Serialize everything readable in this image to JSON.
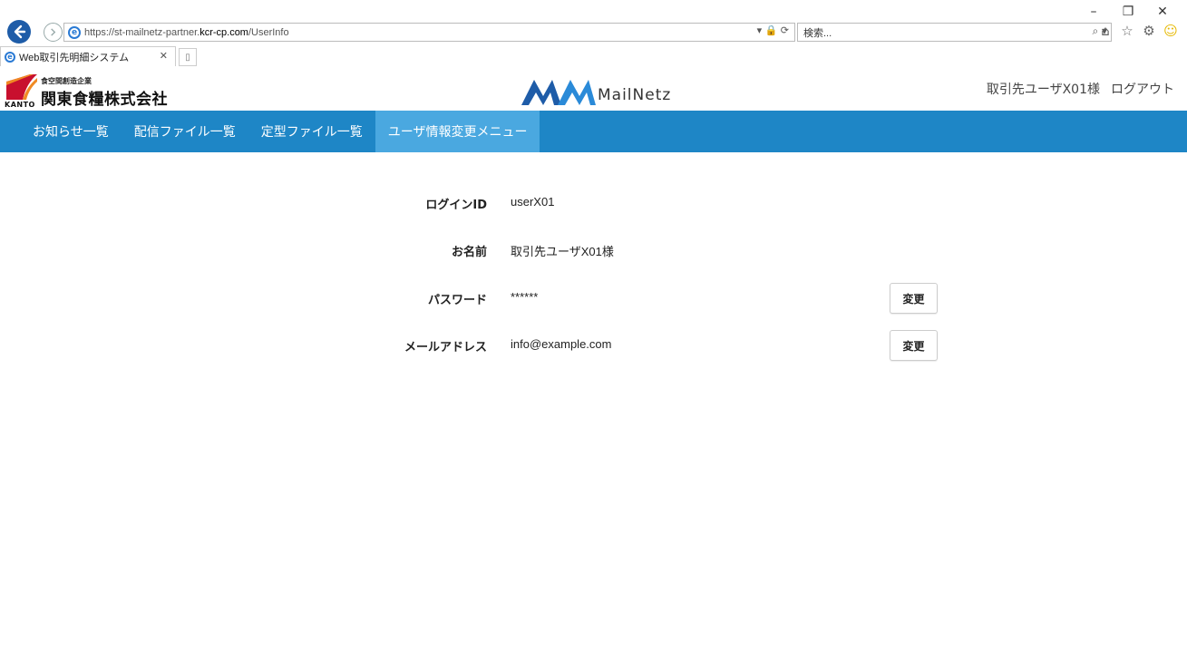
{
  "browser": {
    "url_prefix": "https://",
    "url_host_pre": "st-mailnetz-partner.",
    "url_host_main": "kcr-cp.com",
    "url_path": "/UserInfo",
    "address_tools": "▾ 🔒 ⟳",
    "search_placeholder": "検索...",
    "tab_title": "Web取引先明細システム",
    "window_controls": [
      "–",
      "❐",
      "✕"
    ]
  },
  "header": {
    "company_sub": "食空間創造企業",
    "company_name": "関東食糧株式会社",
    "company_en": "KANTO",
    "brand_name": "MailNetz",
    "user_name": "取引先ユーザX01様",
    "logout_label": "ログアウト"
  },
  "nav": {
    "items": [
      {
        "label": "お知らせ一覧"
      },
      {
        "label": "配信ファイル一覧"
      },
      {
        "label": "定型ファイル一覧"
      },
      {
        "label": "ユーザ情報変更メニュー"
      }
    ]
  },
  "user_info": {
    "login_id_label": "ログインID",
    "login_id_value": "userX01",
    "name_label": "お名前",
    "name_value": "取引先ユーザX01様",
    "password_label": "パスワード",
    "password_value": "******",
    "email_label": "メールアドレス",
    "email_value": "info@example.com",
    "change_label": "変更"
  },
  "colors": {
    "nav_bg": "#1e86c6",
    "nav_active": "#4aa8e0",
    "brand_blue": "#1e5ca8"
  }
}
